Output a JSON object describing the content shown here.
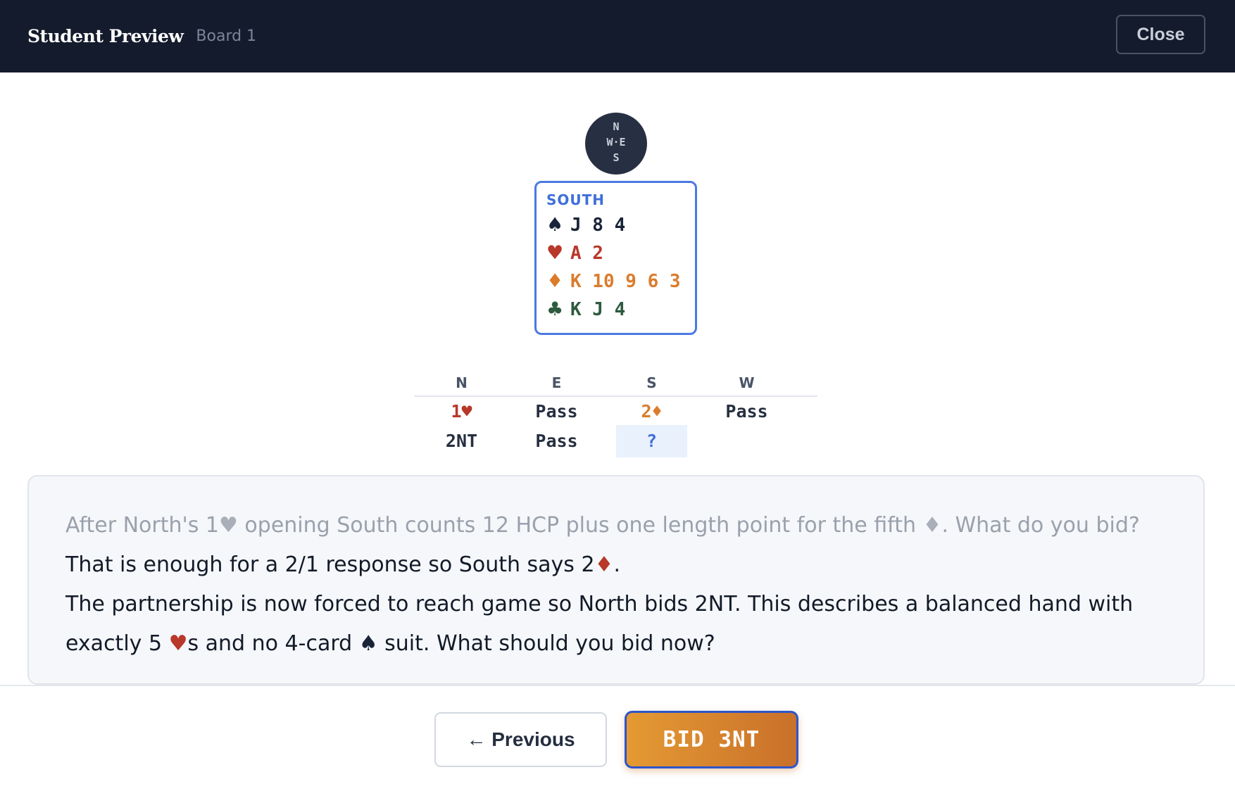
{
  "header": {
    "title": "Student Preview",
    "subtitle": "Board 1",
    "close_label": "Close"
  },
  "compass": {
    "n": "N",
    "we": "W·E",
    "s": "S"
  },
  "hand": {
    "seat": "SOUTH",
    "spades": {
      "symbol": "♠",
      "cards": "J 8 4"
    },
    "hearts": {
      "symbol": "♥",
      "cards": "A 2"
    },
    "diamonds": {
      "symbol": "♦",
      "cards": "K 10 9 6 3"
    },
    "clubs": {
      "symbol": "♣",
      "cards": "K J 4"
    }
  },
  "auction": {
    "headers": [
      "N",
      "E",
      "S",
      "W"
    ],
    "rows": [
      [
        "1♥",
        "Pass",
        "2♦",
        "Pass"
      ],
      [
        "2NT",
        "Pass",
        "?",
        ""
      ]
    ]
  },
  "explanation": {
    "line1_a": "After North's 1",
    "line1_b": " opening South counts 12 HCP plus one length point for the fifth ",
    "line1_c": ". What do you bid?",
    "line2_a": "That is enough for a 2/1 response so South says 2",
    "line2_b": ".",
    "line3_a": "The partnership is now forced to reach game so North bids 2NT. This describes a balanced hand with exactly 5 ",
    "line3_b": "s and no 4-card ",
    "line3_c": " suit.  What should you bid now?",
    "heart_symbol": "♥",
    "diamond_symbol": "♦",
    "spade_symbol": "♠"
  },
  "footer": {
    "previous_label": "← Previous",
    "bid_label": "BID 3NT"
  },
  "colors": {
    "header_bg": "#141b2c",
    "accent_blue": "#3f6fdc",
    "heart_red": "#b8382a",
    "diamond_orange": "#db7c2c",
    "club_green": "#2f5a3f",
    "bid_button_orange": "#e59a33"
  }
}
